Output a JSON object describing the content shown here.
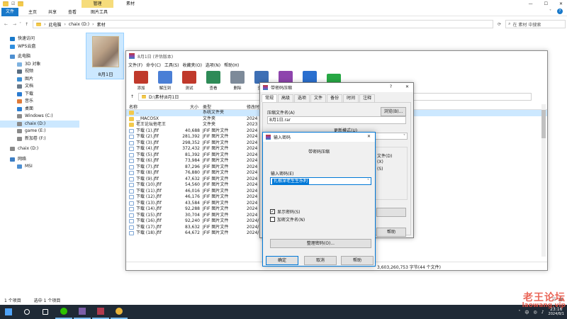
{
  "explorer": {
    "ribbon_group": "管理",
    "ribbon_context": "素材",
    "tabs": [
      "文件",
      "主页",
      "共享",
      "查看",
      "图片工具"
    ],
    "window_controls": [
      "—",
      "☐",
      "✕"
    ],
    "address": {
      "path": [
        "此电脑",
        "chaix (D:)",
        "素材"
      ],
      "search_placeholder": "在 素材 中搜索"
    },
    "sidebar": [
      {
        "label": "快速访问",
        "icon": "star-icon",
        "indent": 0
      },
      {
        "label": "WPS云盘",
        "icon": "cloud-icon",
        "indent": 0
      },
      {
        "label": "此电脑",
        "icon": "computer-icon",
        "indent": 0
      },
      {
        "label": "3D 对象",
        "icon": "cube-icon",
        "indent": 1
      },
      {
        "label": "视频",
        "icon": "video-icon",
        "indent": 1
      },
      {
        "label": "图片",
        "icon": "picture-icon",
        "indent": 1
      },
      {
        "label": "文档",
        "icon": "document-icon",
        "indent": 1
      },
      {
        "label": "下载",
        "icon": "download-icon",
        "indent": 1
      },
      {
        "label": "音乐",
        "icon": "music-icon",
        "indent": 1
      },
      {
        "label": "桌面",
        "icon": "desktop-icon",
        "indent": 1
      },
      {
        "label": "Windows (C:)",
        "icon": "drive-icon",
        "indent": 1
      },
      {
        "label": "chaix (D:)",
        "icon": "drive-icon",
        "indent": 1,
        "selected": true
      },
      {
        "label": "game (E:)",
        "icon": "drive-icon",
        "indent": 1
      },
      {
        "label": "新加卷 (F:)",
        "icon": "drive-icon",
        "indent": 1
      },
      {
        "label": "chaix (D:)",
        "icon": "drive-icon",
        "indent": 0
      },
      {
        "label": "网络",
        "icon": "network-icon",
        "indent": 0
      },
      {
        "label": "MSI",
        "icon": "computer-icon",
        "indent": 1
      }
    ],
    "folder_item": {
      "label": "8月1日"
    },
    "status": {
      "count": "1 个项目",
      "selected": "选中 1 个项目"
    }
  },
  "winrar": {
    "title": "8月1日 (评估版本)",
    "menu": [
      "文件(F)",
      "命令(C)",
      "工具(S)",
      "收藏夹(O)",
      "选项(N)",
      "帮助(H)"
    ],
    "toolbar": [
      {
        "label": "添加",
        "icon": "add-books-icon",
        "color": "#c0392b"
      },
      {
        "label": "解压到",
        "icon": "extract-folder-icon",
        "color": "#4a7fd6"
      },
      {
        "label": "测试",
        "icon": "test-icon",
        "color": "#c0392b"
      },
      {
        "label": "查看",
        "icon": "view-book-icon",
        "color": "#2e8b57"
      },
      {
        "label": "删除",
        "icon": "trash-icon",
        "color": "#7d8a99"
      },
      {
        "label": "查找",
        "icon": "magnifier-icon",
        "color": "#3d6fb5"
      },
      {
        "label": "向导",
        "icon": "wizard-icon",
        "color": "#8e44ad"
      },
      {
        "label": "信息",
        "icon": "info-icon",
        "color": "#2a6fcf"
      },
      {
        "label": "",
        "icon": "export-icon",
        "color": "#27a844"
      }
    ],
    "path": "D:\\素材\\8月1日",
    "columns": {
      "name": "名称",
      "size": "大小",
      "type": "类型",
      "modified": "修改时"
    },
    "rows": [
      {
        "name": "..",
        "size": "",
        "type": "系统文件夹",
        "date": "",
        "kind": "folder"
      },
      {
        "name": "__MACOSX",
        "size": "",
        "type": "文件夹",
        "date": "2024",
        "kind": "folder"
      },
      {
        "name": "老王论坛他老王",
        "size": "",
        "type": "文件夹",
        "date": "2023",
        "kind": "folder"
      },
      {
        "name": "下载 (1).jfif",
        "size": "40,688",
        "type": "JFIF 图片文件",
        "date": "2024",
        "kind": "file"
      },
      {
        "name": "下载 (2).jfif",
        "size": "281,392",
        "type": "JFIF 图片文件",
        "date": "2024",
        "kind": "file"
      },
      {
        "name": "下载 (3).jfif",
        "size": "298,352",
        "type": "JFIF 图片文件",
        "date": "2024",
        "kind": "file"
      },
      {
        "name": "下载 (4).jfif",
        "size": "372,432",
        "type": "JFIF 图片文件",
        "date": "2024",
        "kind": "file"
      },
      {
        "name": "下载 (5).jfif",
        "size": "81,392",
        "type": "JFIF 图片文件",
        "date": "2024",
        "kind": "file"
      },
      {
        "name": "下载 (6).jfif",
        "size": "73,984",
        "type": "JFIF 图片文件",
        "date": "2024",
        "kind": "file"
      },
      {
        "name": "下载 (7).jfif",
        "size": "87,296",
        "type": "JFIF 图片文件",
        "date": "2024",
        "kind": "file"
      },
      {
        "name": "下载 (8).jfif",
        "size": "76,880",
        "type": "JFIF 图片文件",
        "date": "2024",
        "kind": "file"
      },
      {
        "name": "下载 (9).jfif",
        "size": "47,632",
        "type": "JFIF 图片文件",
        "date": "2024",
        "kind": "file"
      },
      {
        "name": "下载 (10).jfif",
        "size": "54,560",
        "type": "JFIF 图片文件",
        "date": "2024",
        "kind": "file"
      },
      {
        "name": "下载 (11).jfif",
        "size": "46,016",
        "type": "JFIF 图片文件",
        "date": "2024",
        "kind": "file"
      },
      {
        "name": "下载 (12).jfif",
        "size": "46,176",
        "type": "JFIF 图片文件",
        "date": "2024",
        "kind": "file"
      },
      {
        "name": "下载 (13).jfif",
        "size": "43,584",
        "type": "JFIF 图片文件",
        "date": "2024",
        "kind": "file"
      },
      {
        "name": "下载 (14).jfif",
        "size": "92,288",
        "type": "JFIF 图片文件",
        "date": "2024",
        "kind": "file"
      },
      {
        "name": "下载 (15).jfif",
        "size": "30,704",
        "type": "JFIF 图片文件",
        "date": "2024",
        "kind": "file"
      },
      {
        "name": "下载 (16).jfif",
        "size": "92,240",
        "type": "JFIF 图片文件",
        "date": "2024/7",
        "kind": "file"
      },
      {
        "name": "下载 (17).jfif",
        "size": "83,632",
        "type": "JFIF 图片文件",
        "date": "2024/7",
        "kind": "file"
      },
      {
        "name": "下载 (18).jfif",
        "size": "64,672",
        "type": "JFIF 图片文件",
        "date": "2024/7",
        "kind": "file"
      }
    ],
    "status": "3,603,260,753 字节(44 个文件)"
  },
  "archive_dialog": {
    "title": "带密码压缩",
    "tabs": [
      "常规",
      "高级",
      "选项",
      "文件",
      "备份",
      "时间",
      "注释"
    ],
    "archive_name_label": "压缩文件名(A)",
    "archive_name": "8月1日.rar",
    "browse": "浏览(B)...",
    "update_mode_label": "更新模式(U)",
    "right_opts": [
      "文件(D)",
      "(X)",
      "(S)"
    ],
    "help": "帮助",
    "question": "?",
    "close": "✕"
  },
  "password_dialog": {
    "title": "输入密码",
    "heading": "带密码压缩",
    "label": "输入密码(E)",
    "value": "扎根深老生生乐利",
    "show_password": "显示密码(S)",
    "show_checked": true,
    "encrypt_names": "加密文件名(N)",
    "encrypt_checked": false,
    "organize": "整理密码(O)...",
    "ok": "确定",
    "cancel": "取消",
    "help": "帮助",
    "close": "✕"
  },
  "taskbar": {
    "tray_time": "23:16",
    "tray_date": "2024/8/1",
    "tray_lang": "中",
    "icons": [
      "windows-icon",
      "search-icon",
      "task-view-icon",
      "wechat-icon",
      "app-icon",
      "winrar-icon",
      "chrome-icon"
    ]
  },
  "watermark": {
    "line1": "老王论坛",
    "line2": "laowang.vip"
  }
}
